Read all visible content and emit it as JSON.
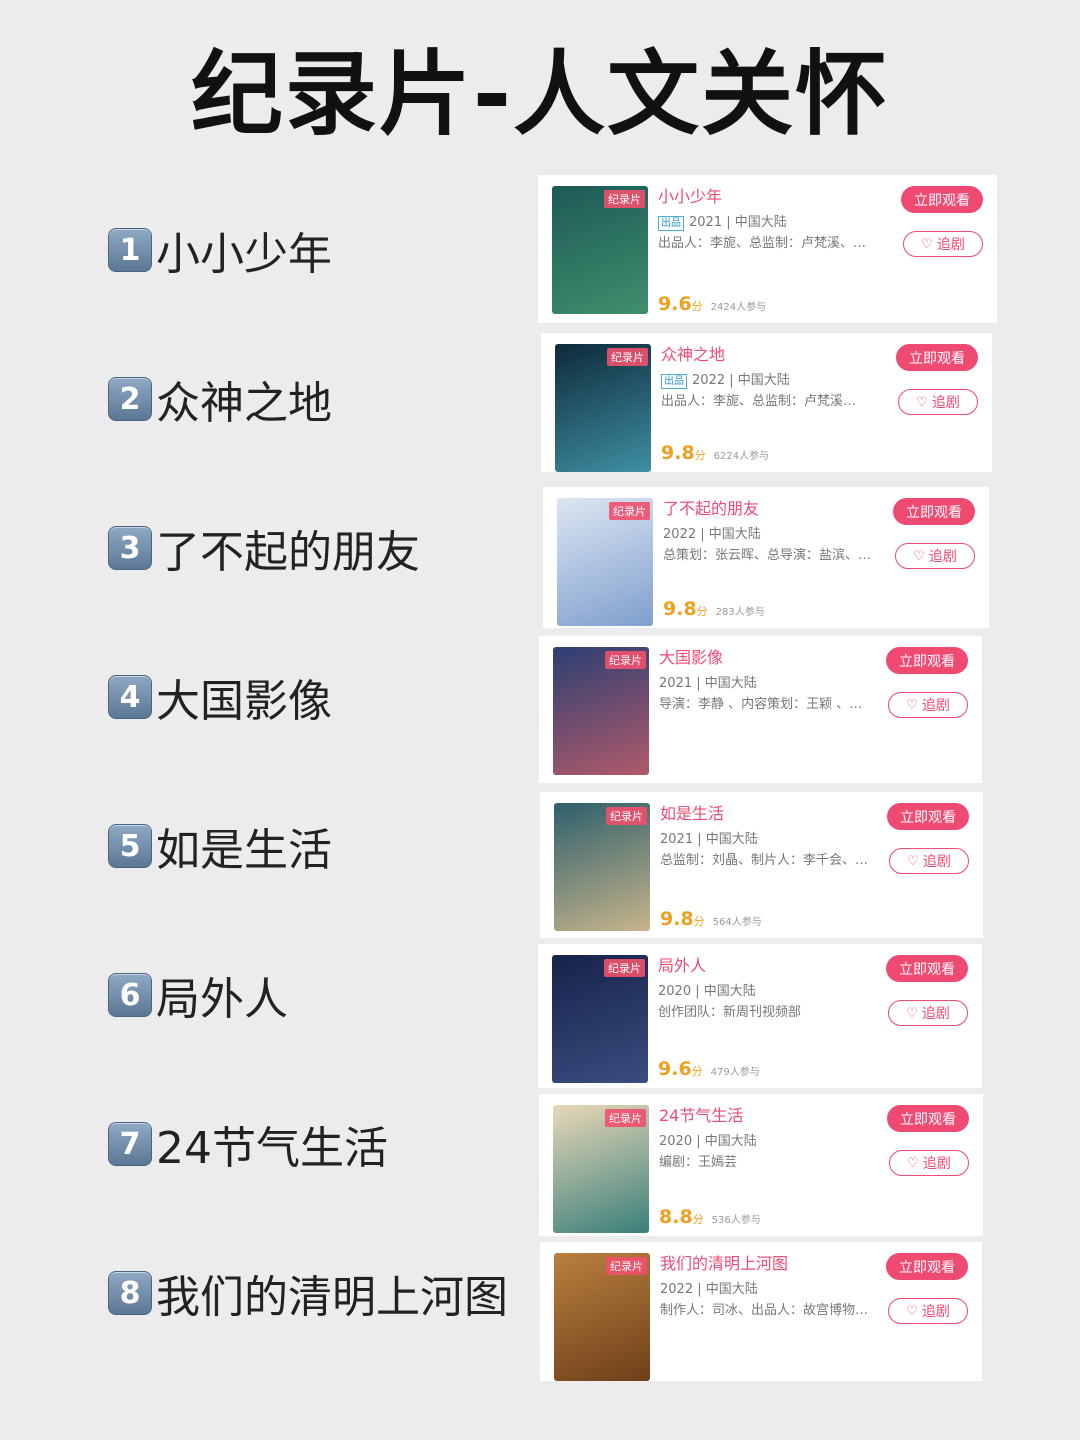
{
  "page_title": "纪录片-人文关怀",
  "list": [
    {
      "num": "1",
      "name": "小小少年"
    },
    {
      "num": "2",
      "name": "众神之地"
    },
    {
      "num": "3",
      "name": "了不起的朋友"
    },
    {
      "num": "4",
      "name": "大国影像"
    },
    {
      "num": "5",
      "name": "如是生活"
    },
    {
      "num": "6",
      "name": "局外人"
    },
    {
      "num": "7",
      "name": "24节气生活"
    },
    {
      "num": "8",
      "name": "我们的清明上河图"
    }
  ],
  "cards": [
    {
      "tag": "纪录片",
      "title": "小小少年",
      "source_badge": "出品",
      "meta": "2021 | 中国大陆",
      "crew": "出品人：李旎、总监制：卢梵溪、…",
      "score": "9.6",
      "score_unit": "分",
      "participants": "2424人参与",
      "watch": "立即观看",
      "follow": "追剧",
      "poster_colors": [
        "#1d5a57",
        "#3f8f6c"
      ]
    },
    {
      "tag": "纪录片",
      "title": "众神之地",
      "source_badge": "出品",
      "meta": "2022 | 中国大陆",
      "crew": "出品人：李旎、总监制：卢梵溪…",
      "score": "9.8",
      "score_unit": "分",
      "participants": "6224人参与",
      "watch": "立即观看",
      "follow": "追剧",
      "poster_colors": [
        "#0d2a3a",
        "#3f8fa3"
      ]
    },
    {
      "tag": "纪录片",
      "title": "了不起的朋友",
      "source_badge": "",
      "meta": "2022 | 中国大陆",
      "crew": "总策划：张云晖、总导演：盐滨、…",
      "score": "9.8",
      "score_unit": "分",
      "participants": "283人参与",
      "watch": "立即观看",
      "follow": "追剧",
      "poster_colors": [
        "#dde6f2",
        "#7f9fce"
      ]
    },
    {
      "tag": "纪录片",
      "title": "大国影像",
      "source_badge": "",
      "meta": "2021 | 中国大陆",
      "crew": "导演：李静 、内容策划：王颖 、…",
      "score": "",
      "score_unit": "",
      "participants": "",
      "watch": "立即观看",
      "follow": "追剧",
      "poster_colors": [
        "#2c3f72",
        "#b05a6a"
      ]
    },
    {
      "tag": "纪录片",
      "title": "如是生活",
      "source_badge": "",
      "meta": "2021 | 中国大陆",
      "crew": "总监制：刘晶、制片人：李千会、…",
      "score": "9.8",
      "score_unit": "分",
      "participants": "564人参与",
      "watch": "立即观看",
      "follow": "追剧",
      "poster_colors": [
        "#2e5f6b",
        "#c6b48b"
      ]
    },
    {
      "tag": "纪录片",
      "title": "局外人",
      "source_badge": "",
      "meta": "2020 | 中国大陆",
      "crew": "创作团队：新周刊视频部",
      "score": "9.6",
      "score_unit": "分",
      "participants": "479人参与",
      "watch": "立即观看",
      "follow": "追剧",
      "poster_colors": [
        "#16234a",
        "#3a4d80"
      ]
    },
    {
      "tag": "纪录片",
      "title": "24节气生活",
      "source_badge": "",
      "meta": "2020 | 中国大陆",
      "crew": "编剧：王嫣芸",
      "score": "8.8",
      "score_unit": "分",
      "participants": "536人参与",
      "watch": "立即观看",
      "follow": "追剧",
      "poster_colors": [
        "#e8d8b8",
        "#3a7f7a"
      ]
    },
    {
      "tag": "纪录片",
      "title": "我们的清明上河图",
      "source_badge": "",
      "meta": "2022 | 中国大陆",
      "crew": "制作人：司冰、出品人：故宫博物…",
      "score": "",
      "score_unit": "",
      "participants": "",
      "watch": "立即观看",
      "follow": "追剧",
      "poster_colors": [
        "#b9803e",
        "#6e3f1a"
      ]
    }
  ]
}
